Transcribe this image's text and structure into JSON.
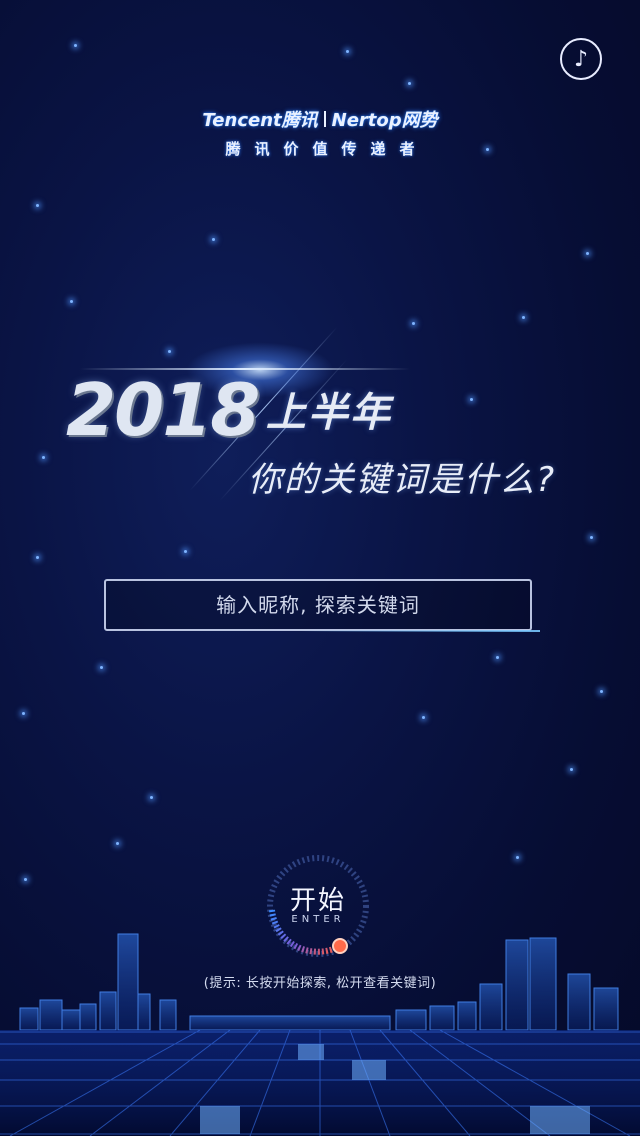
{
  "music": {
    "icon": "music-note-icon",
    "glyph": "♪"
  },
  "logo": {
    "brand_left": "Tencent腾讯",
    "brand_right": "Nertop网势",
    "slogan": "腾讯价值传递者"
  },
  "headline": {
    "year": "2018",
    "half": "上半年",
    "question": "你的关键词是什么?"
  },
  "nickname_input": {
    "placeholder": "输入昵称, 探索关键词",
    "value": ""
  },
  "start_button": {
    "label_cn": "开始",
    "label_en": "ENTER"
  },
  "hint": "(提示: 长按开始探索, 松开查看关键词)",
  "colors": {
    "background": "#060d33",
    "accent": "#3a8bff",
    "progress_dot": "#ff5a3c"
  }
}
